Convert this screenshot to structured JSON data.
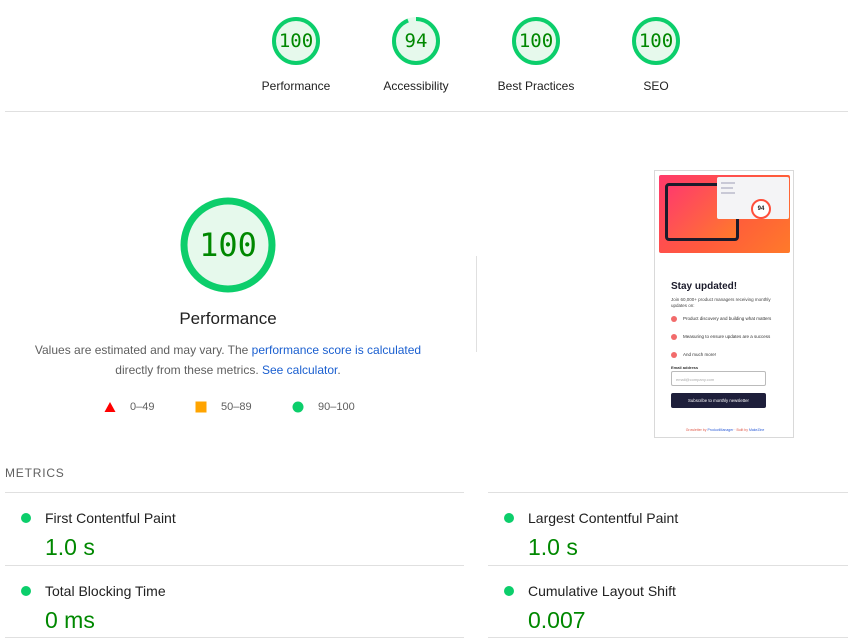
{
  "categories": [
    {
      "label": "Performance",
      "score": "100",
      "value": 100
    },
    {
      "label": "Accessibility",
      "score": "94",
      "value": 94
    },
    {
      "label": "Best Practices",
      "score": "100",
      "value": 100
    },
    {
      "label": "SEO",
      "score": "100",
      "value": 100
    }
  ],
  "performance": {
    "score": "100",
    "title": "Performance",
    "desc_prefix": "Values are estimated and may vary. The ",
    "desc_link1": "performance score is calculated",
    "desc_middle": " directly from these metrics. ",
    "desc_link2": "See calculator",
    "desc_suffix": "."
  },
  "legend": [
    {
      "range": "0–49",
      "shape": "triangle",
      "color": "#ff0000"
    },
    {
      "range": "50–89",
      "shape": "square",
      "color": "#ffa400"
    },
    {
      "range": "90–100",
      "shape": "circle",
      "color": "#0cce6b"
    }
  ],
  "colors": {
    "pass": "#0cce6b",
    "pass_text": "#008800",
    "gauge_fill": "#e6f9ec",
    "link": "#1a5fd0"
  },
  "thumbnail": {
    "badge": "94",
    "title": "Stay updated!",
    "subtitle": "Join 60,000+ product managers receiving monthly updates on:",
    "bullets": [
      "Product discovery and building what matters",
      "Measuring to ensure updates are a success",
      "And much more!"
    ],
    "email_label": "Email address",
    "email_placeholder": "email@company.com",
    "button": "Subscribe to monthly newsletter",
    "footer_prefix": "Growletter by ",
    "footer_link1": "ProductManager",
    "footer_middle": " · Built by ",
    "footer_link2": "MakeZine"
  },
  "metrics": {
    "header": "METRICS",
    "items": [
      {
        "name": "First Contentful Paint",
        "value": "1.0 s"
      },
      {
        "name": "Largest Contentful Paint",
        "value": "1.0 s"
      },
      {
        "name": "Total Blocking Time",
        "value": "0 ms"
      },
      {
        "name": "Cumulative Layout Shift",
        "value": "0.007"
      }
    ]
  }
}
